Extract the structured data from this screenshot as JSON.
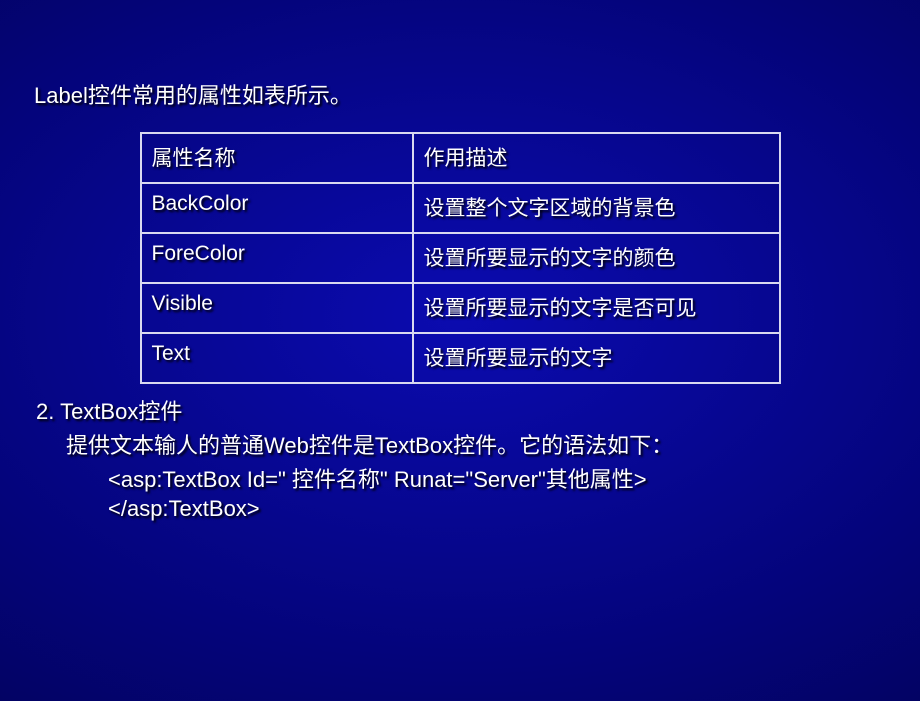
{
  "lead": "Label控件常用的属性如表所示。",
  "table": {
    "h1": "属性名称",
    "h2": "作用描述",
    "rows": [
      {
        "c1": "BackColor",
        "c2": "设置整个文字区域的背景色"
      },
      {
        "c1": "ForeColor",
        "c2": "设置所要显示的文字的颜色"
      },
      {
        "c1": "Visible",
        "c2": "设置所要显示的文字是否可见"
      },
      {
        "c1": "Text",
        "c2": "设置所要显示的文字"
      }
    ]
  },
  "section": "2. TextBox控件",
  "para": "提供文本输人的普通Web控件是TextBox控件。它的语法如下：",
  "code1": "<asp:TextBox Id=\" 控件名称\" Runat=\"Server\"其他属性>",
  "code2": "</asp:TextBox>"
}
